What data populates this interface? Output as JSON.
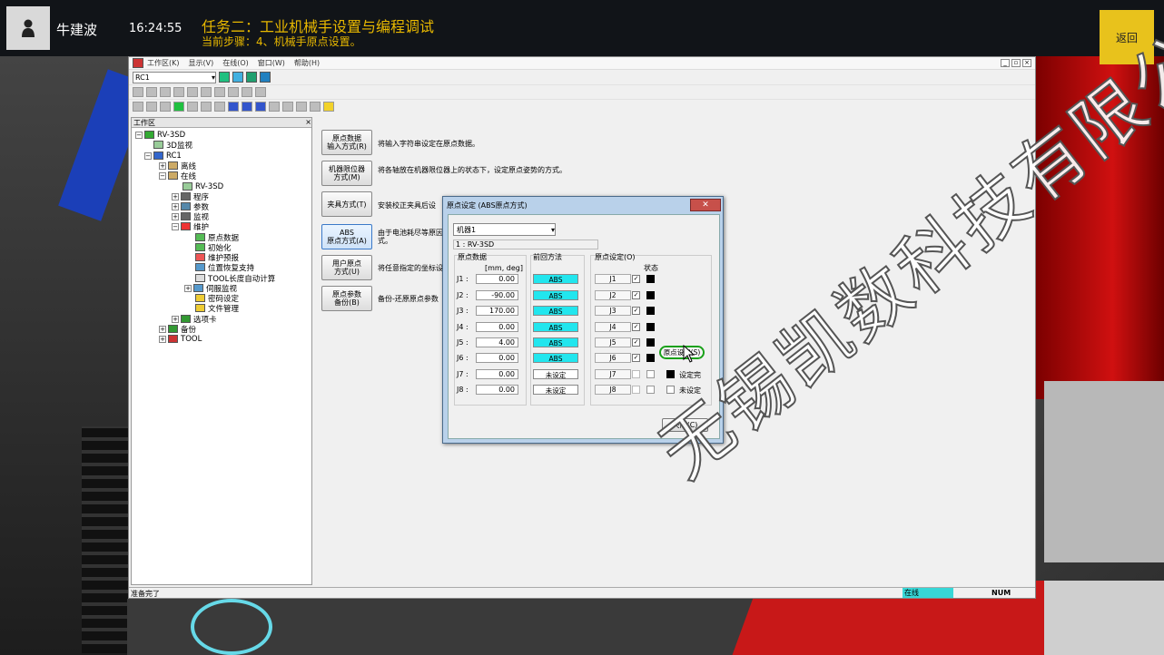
{
  "header": {
    "username": "牛建波",
    "clock": "16:24:55",
    "task_title": "任务二：工业机械手设置与编程调试",
    "task_step": "当前步骤：4、机械手原点设置。",
    "back_label": "返回"
  },
  "app": {
    "menu": [
      "工作区(K)",
      "显示(V)",
      "在线(O)",
      "窗口(W)",
      "帮助(H)"
    ],
    "controller_select": "RC1",
    "workarea_title": "工作区",
    "tree": [
      {
        "label": "RV-3SD",
        "expand": "−"
      },
      {
        "label": "3D监视",
        "expand": ""
      },
      {
        "label": "RC1",
        "expand": "−"
      },
      {
        "label": "离线",
        "expand": "+"
      },
      {
        "label": "在线",
        "expand": "−"
      },
      {
        "label": "RV-3SD",
        "expand": ""
      },
      {
        "label": "程序",
        "expand": "+"
      },
      {
        "label": "参数",
        "expand": "+"
      },
      {
        "label": "监视",
        "expand": "+"
      },
      {
        "label": "维护",
        "expand": "−"
      },
      {
        "label": "原点数据",
        "expand": ""
      },
      {
        "label": "初始化",
        "expand": ""
      },
      {
        "label": "维护预报",
        "expand": ""
      },
      {
        "label": "位置恢复支持",
        "expand": ""
      },
      {
        "label": "TOOL长度自动计算",
        "expand": ""
      },
      {
        "label": "伺服监视",
        "expand": "+"
      },
      {
        "label": "密码设定",
        "expand": ""
      },
      {
        "label": "文件管理",
        "expand": ""
      },
      {
        "label": "选项卡",
        "expand": "+"
      },
      {
        "label": "备份",
        "expand": "+"
      },
      {
        "label": "TOOL",
        "expand": "+"
      }
    ],
    "options": [
      {
        "button": "原点数据\n输入方式(R)",
        "desc": "将输入字符串设定在原点数据。"
      },
      {
        "button": "机器限位器\n方式(M)",
        "desc": "将各轴放在机器限位器上的状态下，设定原点姿势的方式。"
      },
      {
        "button": "夹具方式(T)",
        "desc": "安装校正夹具后设"
      },
      {
        "button": "ABS\n原点方式(A)",
        "desc": "由于电池耗尽等原因\n式。"
      },
      {
        "button": "用户原点\n方式(U)",
        "desc": "将任意指定的坐标设"
      },
      {
        "button": "原点参数\n备份(B)",
        "desc": "备份-还原原点参数"
      }
    ],
    "status_left": "准备完了",
    "status_online": "在线",
    "status_num": "NUM"
  },
  "dialog": {
    "title": "原点设定 (ABS原点方式)",
    "close_x": "✕",
    "machine_select": "机器1",
    "robot": "1 : RV-3SD",
    "group_data": "原点数据",
    "unit": "[mm, deg]",
    "group_method": "前回方法",
    "group_set": "原点设定(O)",
    "status_header": "状态",
    "joints": [
      {
        "label": "J1 :",
        "value": "0.00",
        "method": "ABS",
        "axis": "J1",
        "checked": true,
        "status": "set"
      },
      {
        "label": "J2 :",
        "value": "-90.00",
        "method": "ABS",
        "axis": "J2",
        "checked": true,
        "status": "set"
      },
      {
        "label": "J3 :",
        "value": "170.00",
        "method": "ABS",
        "axis": "J3",
        "checked": true,
        "status": "set"
      },
      {
        "label": "J4 :",
        "value": "0.00",
        "method": "ABS",
        "axis": "J4",
        "checked": true,
        "status": "set"
      },
      {
        "label": "J5 :",
        "value": "4.00",
        "method": "ABS",
        "axis": "J5",
        "checked": true,
        "status": "set"
      },
      {
        "label": "J6 :",
        "value": "0.00",
        "method": "ABS",
        "axis": "J6",
        "checked": true,
        "status": "set"
      },
      {
        "label": "J7 :",
        "value": "0.00",
        "method": "未设定",
        "axis": "J7",
        "checked": false,
        "status": "unset"
      },
      {
        "label": "J8 :",
        "value": "0.00",
        "method": "未设定",
        "axis": "J8",
        "checked": false,
        "status": "unset"
      }
    ],
    "set_button": "原点设定(S)",
    "legend_set": "设定完",
    "legend_unset": "未设定",
    "close_button": "关闭(C)",
    "colors": {
      "abs": "#22e6ee",
      "status_set": "#000000",
      "highlight": "#19a119"
    }
  },
  "watermark": "无锡凯数科技有限公司"
}
